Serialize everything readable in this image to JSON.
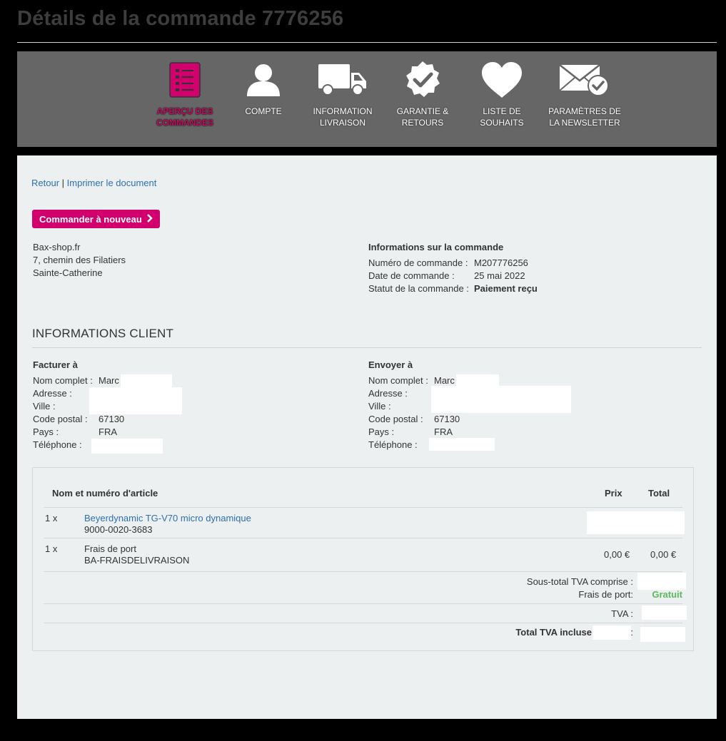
{
  "page": {
    "title": "Détails de la commande 7776256"
  },
  "nav": {
    "items": [
      {
        "label_1": "APERÇU DES",
        "label_2": "COMMANDES",
        "icon": "order-list-icon",
        "active": true
      },
      {
        "label_1": "COMPTE",
        "label_2": "",
        "icon": "user-icon"
      },
      {
        "label_1": "INFORMATION",
        "label_2": "LIVRAISON",
        "icon": "delivery-truck-icon"
      },
      {
        "label_1": "GARANTIE &",
        "label_2": "RETOURS",
        "icon": "warranty-badge-icon"
      },
      {
        "label_1": "LISTE DE",
        "label_2": "SOUHAITS",
        "icon": "heart-icon"
      },
      {
        "label_1": "PARAMÈTRES DE",
        "label_2": "LA NEWSLETTER",
        "icon": "newsletter-envelope-icon"
      }
    ],
    "active_color": "#c0105f"
  },
  "links": {
    "back": "Retour",
    "separator": "|",
    "print": "Imprimer le document"
  },
  "reorder": {
    "label": "Commander à nouveau",
    "color": "#d1006d"
  },
  "store": {
    "name": "Bax-shop.fr",
    "street": "7, chemin des Filatiers",
    "city": "Sainte-Catherine"
  },
  "order_info": {
    "heading": "Informations sur la commande",
    "number_label": "Numéro de commande :",
    "number": "M207776256",
    "date_label": "Date de commande :",
    "date": "25 mai 2022",
    "status_label": "Statut de la commande :",
    "status": "Paiement reçu"
  },
  "customer": {
    "section_title": "INFORMATIONS CLIENT",
    "billing": {
      "heading": "Facturer à",
      "name_label": "Nom complet :",
      "name": "Marc",
      "address_label": "Adresse :",
      "city_label": "Ville :",
      "zip_label": "Code postal :",
      "zip": "67130",
      "country_label": "Pays :",
      "country": "FRA",
      "phone_label": "Téléphone :"
    },
    "shipping": {
      "heading": "Envoyer à",
      "name_label": "Nom complet :",
      "name": "Marc",
      "address_label": "Adresse :",
      "city_label": "Ville :",
      "zip_label": "Code postal :",
      "zip": "67130",
      "country_label": "Pays :",
      "country": "FRA",
      "phone_label": "Téléphone :"
    }
  },
  "items": {
    "col_name": "Nom et numéro d'article",
    "col_price": "Prix",
    "col_total": "Total",
    "rows": [
      {
        "qty": "1 x",
        "name": "Beyerdynamic TG-V70 micro dynamique",
        "sku": "9000-0020-3683",
        "price": "",
        "total": ""
      },
      {
        "qty": "1 x",
        "name": "Frais de port",
        "sku": "BA-FRAISDELIVRAISON",
        "price": "0,00 €",
        "total": "0,00 €"
      }
    ],
    "subtotal_label": "Sous-total TVA comprise :",
    "shipping_label": "Frais de port:",
    "shipping_value": "Gratuit",
    "tva_label": "TVA :",
    "total_label": "Total TVA incluse",
    "total_colon": ":"
  }
}
